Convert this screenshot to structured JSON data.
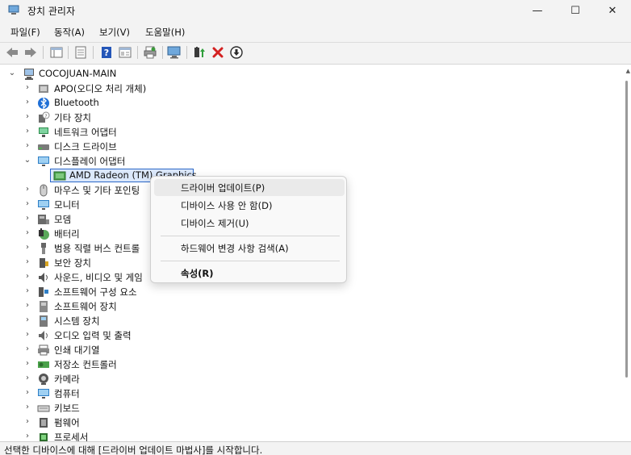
{
  "window": {
    "title": "장치 관리자",
    "min_glyph": "—",
    "max_glyph": "☐",
    "close_glyph": "✕"
  },
  "menu": [
    "파일(F)",
    "동작(A)",
    "보기(V)",
    "도움말(H)"
  ],
  "tree": {
    "root": "COCOJUAN-MAIN",
    "categories": [
      {
        "label": "APO(오디오 처리 개체)",
        "icon": "audio-processing-icon"
      },
      {
        "label": "Bluetooth",
        "icon": "bluetooth-icon"
      },
      {
        "label": "기타 장치",
        "icon": "unknown-device-icon"
      },
      {
        "label": "네트워크 어댑터",
        "icon": "network-adapter-icon"
      },
      {
        "label": "디스크 드라이브",
        "icon": "disk-drive-icon"
      },
      {
        "label": "디스플레이 어댑터",
        "icon": "display-adapter-icon",
        "expanded": true
      },
      {
        "label": "마우스 및 기타 포인팅",
        "icon": "mouse-icon"
      },
      {
        "label": "모니터",
        "icon": "monitor-icon"
      },
      {
        "label": "모뎀",
        "icon": "modem-icon"
      },
      {
        "label": "배터리",
        "icon": "battery-icon"
      },
      {
        "label": "범용 직렬 버스 컨트롤",
        "icon": "usb-controller-icon"
      },
      {
        "label": "보안 장치",
        "icon": "security-device-icon"
      },
      {
        "label": "사운드, 비디오 및 게임",
        "icon": "sound-icon"
      },
      {
        "label": "소프트웨어 구성 요소",
        "icon": "software-component-icon"
      },
      {
        "label": "소프트웨어 장치",
        "icon": "software-device-icon"
      },
      {
        "label": "시스템 장치",
        "icon": "system-device-icon"
      },
      {
        "label": "오디오 입력 및 출력",
        "icon": "audio-io-icon"
      },
      {
        "label": "인쇄 대기열",
        "icon": "print-queue-icon"
      },
      {
        "label": "저장소 컨트롤러",
        "icon": "storage-controller-icon"
      },
      {
        "label": "카메라",
        "icon": "camera-icon"
      },
      {
        "label": "컴퓨터",
        "icon": "computer-icon"
      },
      {
        "label": "키보드",
        "icon": "keyboard-icon"
      },
      {
        "label": "펌웨어",
        "icon": "firmware-icon"
      },
      {
        "label": "프로세서",
        "icon": "processor-icon"
      }
    ],
    "selected_device": "AMD Radeon (TM) Graphics"
  },
  "context_menu": {
    "items": [
      "드라이버 업데이트(P)",
      "디바이스 사용 안 함(D)",
      "디바이스 제거(U)",
      "하드웨어 변경 사항 검색(A)",
      "속성(R)"
    ]
  },
  "status": "선택한 디바이스에 대해 [드라이버 업데이트 마법사]를 시작합니다.",
  "colors": {
    "selection": "#dbe8fb",
    "selection_border": "#2b67c7",
    "delete_red": "#d32020",
    "help_blue": "#2456b8"
  }
}
